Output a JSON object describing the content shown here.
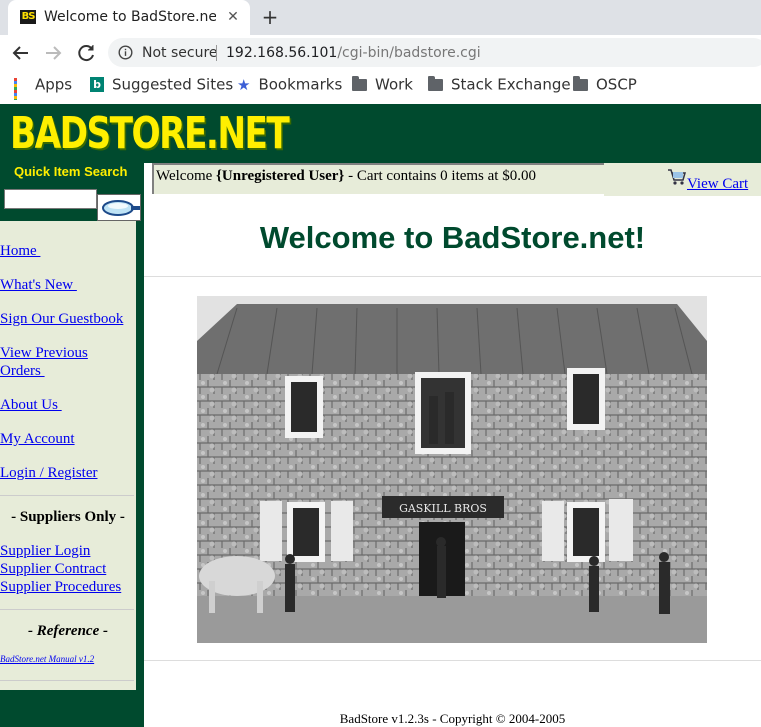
{
  "browser": {
    "tab": {
      "favicon_text": "BS",
      "title": "Welcome to BadStore.net"
    },
    "omnibox": {
      "security_label": "Not secure",
      "url_host": "192.168.56.101",
      "url_path": "/cgi-bin/badstore.cgi"
    },
    "bookmarks": [
      {
        "label": "Apps",
        "icon": "apps-grid-icon"
      },
      {
        "label": "Suggested Sites",
        "icon": "bing-icon"
      },
      {
        "label": "Bookmarks",
        "icon": "star-icon"
      },
      {
        "label": "Work",
        "icon": "folder-icon"
      },
      {
        "label": "Stack Exchange",
        "icon": "folder-icon"
      },
      {
        "label": "OSCP",
        "icon": "folder-icon"
      }
    ]
  },
  "site": {
    "logo": "BADSTORE.NET",
    "quick_search_label": "Quick Item Search",
    "search_value": "",
    "nav": [
      {
        "label": "Home "
      },
      {
        "label": "What's New "
      },
      {
        "label": "Sign Our Guestbook"
      },
      {
        "label": "View Previous\nOrders "
      },
      {
        "label": "About Us "
      },
      {
        "label": "My Account"
      },
      {
        "label": "Login / Register"
      }
    ],
    "suppliers_heading": "- Suppliers Only -",
    "supplier_links": [
      {
        "label": "Supplier Login"
      },
      {
        "label": "Supplier Contract"
      },
      {
        "label": "Supplier Procedures"
      }
    ],
    "reference_heading": "- Reference -",
    "manual_link": "BadStore.net Manual v1.2",
    "welcome": {
      "prefix": "Welcome ",
      "user": "{Unregistered User}",
      "suffix": " - Cart contains 0 items at $0.00"
    },
    "view_cart": "View Cart",
    "main_title": "Welcome to BadStore.net!",
    "store_sign": "GASKILL BROS",
    "copyright": "BadStore v1.2.3s - Copyright © 2004-2005"
  },
  "colors": {
    "brand_green": "#004a2e",
    "logo_yellow": "#ffef00",
    "sidebar_bg": "#e7ecd9",
    "link": "#0000ee"
  }
}
